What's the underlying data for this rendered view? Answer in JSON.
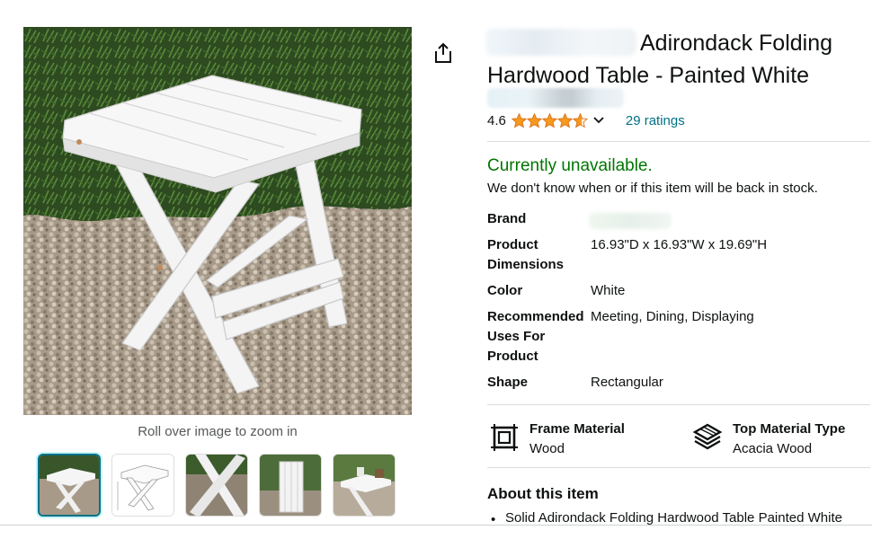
{
  "product": {
    "title": "Adirondack Folding Hardwood Table - Painted White",
    "rating_value": "4.6",
    "ratings_count_label": "29 ratings",
    "rating_stars": 4.6,
    "availability": "Currently unavailable.",
    "availability_note": "We don't know when or if this item will be back in stock."
  },
  "gallery": {
    "zoom_hint": "Roll over image to zoom in",
    "thumbnail_count": 5,
    "selected_index": 0
  },
  "specs": {
    "brand_label": "Brand",
    "dimensions_label": "Product Dimensions",
    "dimensions_value": "16.93\"D x 16.93\"W x 19.69\"H",
    "color_label": "Color",
    "color_value": "White",
    "uses_label": "Recommended Uses For Product",
    "uses_value": "Meeting, Dining, Displaying",
    "shape_label": "Shape",
    "shape_value": "Rectangular"
  },
  "features": {
    "frame_label": "Frame Material",
    "frame_value": "Wood",
    "top_label": "Top Material Type",
    "top_value": "Acacia Wood"
  },
  "about": {
    "heading": "About this item",
    "bullet_1": "Solid Adirondack Folding Hardwood Table Painted White"
  },
  "colors": {
    "link": "#007185",
    "available_green": "#007600",
    "star": "#f79a1b",
    "text": "#0f1111"
  },
  "icons": {
    "share": "share-icon",
    "chevron": "chevron-down-icon",
    "frame": "frame-material-icon",
    "top": "layers-icon"
  }
}
